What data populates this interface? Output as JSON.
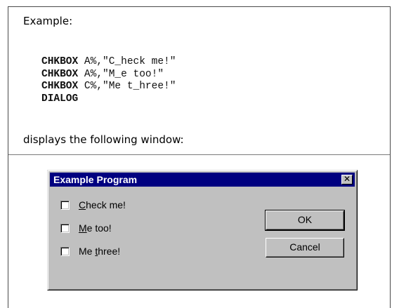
{
  "doc": {
    "heading": "Example:",
    "code_lines": [
      {
        "kw": "CHKBOX",
        "rest": " A%,\"C_heck me!\""
      },
      {
        "kw": "CHKBOX",
        "rest": " A%,\"M_e too!\""
      },
      {
        "kw": "CHKBOX",
        "rest": " C%,\"Me t_hree!\""
      },
      {
        "kw": "DIALOG",
        "rest": ""
      }
    ],
    "description": "displays the following window:"
  },
  "dialog": {
    "title": "Example Program",
    "close_glyph": "✕",
    "checkboxes": [
      {
        "pre": "",
        "u": "C",
        "post": "heck me!",
        "checked": false
      },
      {
        "pre": "",
        "u": "M",
        "post": "e too!",
        "checked": false
      },
      {
        "pre": "Me ",
        "u": "t",
        "post": "hree!",
        "checked": false
      }
    ],
    "buttons": {
      "ok": "OK",
      "cancel": "Cancel"
    },
    "colors": {
      "titlebar": "#000080",
      "face": "#c0c0c0"
    }
  }
}
